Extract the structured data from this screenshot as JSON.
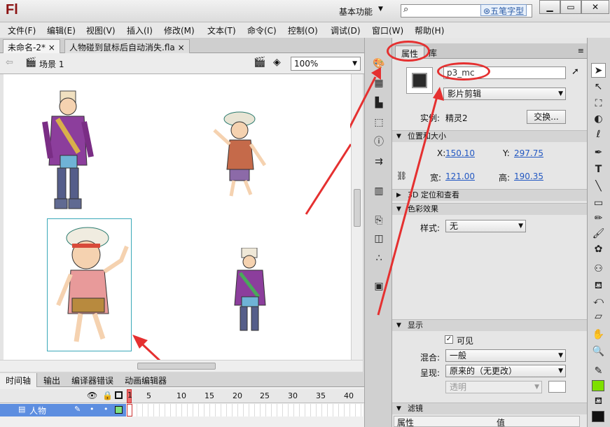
{
  "app": {
    "logo": "Fl",
    "workspace": "基本功能",
    "search_icon": "⌕",
    "watermark": "五笔字型"
  },
  "window_buttons": [
    "▁",
    "▭",
    "✕"
  ],
  "menu": [
    "文件(F)",
    "编辑(E)",
    "视图(V)",
    "插入(I)",
    "修改(M)",
    "文本(T)",
    "命令(C)",
    "控制(O)",
    "调试(D)",
    "窗口(W)",
    "帮助(H)"
  ],
  "doc_tabs": [
    {
      "label": "未命名-2*",
      "close": "×"
    },
    {
      "label": "人物碰到鼠标后自动消失.fla",
      "close": "×"
    }
  ],
  "scene": {
    "label": "场景 1",
    "zoom": "100%"
  },
  "timeline": {
    "tabs": [
      "时间轴",
      "输出",
      "编译器错误",
      "动画编辑器"
    ],
    "frame_numbers": [
      "5",
      "10",
      "15",
      "20",
      "25",
      "30",
      "35",
      "40"
    ],
    "layer_name": "人物",
    "current_frame": "1"
  },
  "properties": {
    "tabs": [
      "属性",
      "库"
    ],
    "instance_name": "p3_mc",
    "symbol_type": "影片剪辑",
    "instance_label": "实例:",
    "instance_of": "精灵2",
    "swap_button": "交换...",
    "position_section": "位置和大小",
    "x_label": "X:",
    "x_value": "150.10",
    "y_label": "Y:",
    "y_value": "297.75",
    "w_label": "宽:",
    "w_value": "121.00",
    "h_label": "高:",
    "h_value": "190.35",
    "section_3d": "3D 定位和查看",
    "color_section": "色彩效果",
    "style_label": "样式:",
    "style_value": "无",
    "display_section": "显示",
    "visible_label": "可见",
    "blend_label": "混合:",
    "blend_value": "一般",
    "render_label": "呈现:",
    "render_value": "原来的（无更改）",
    "transparent_value": "透明",
    "filters_section": "滤镜",
    "filter_col_property": "属性",
    "filter_col_value": "值"
  },
  "colors": {
    "accent": "#e53030",
    "stroke_swatch": "#111111",
    "fill_swatch": "#7ee000",
    "link": "#2358c2"
  }
}
